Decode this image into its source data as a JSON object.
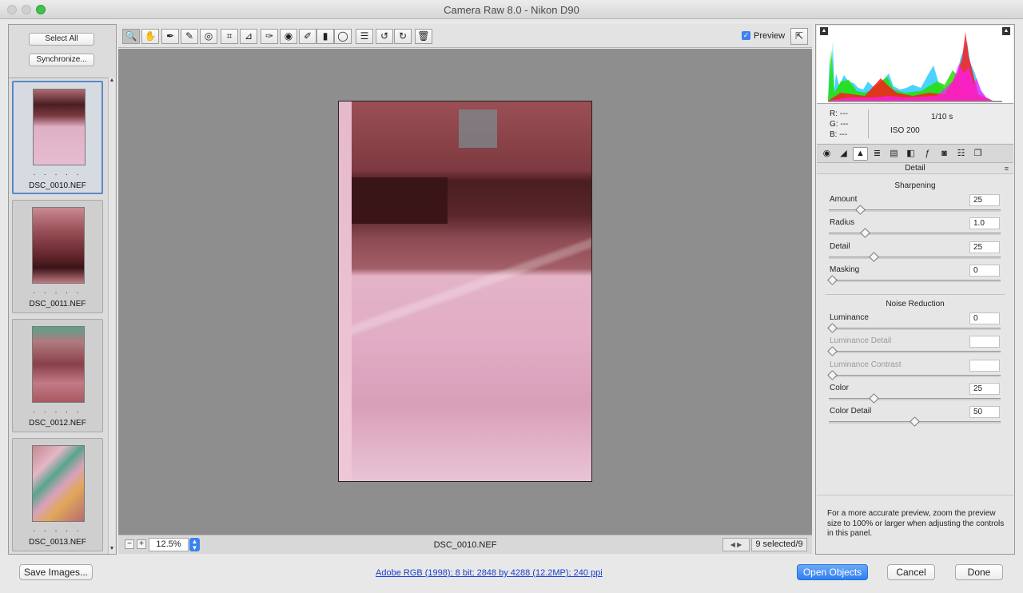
{
  "window": {
    "title": "Camera Raw 8.0  -  Nikon D90"
  },
  "filmstrip": {
    "select_all": "Select All",
    "synchronize": "Synchronize...",
    "items": [
      {
        "name": "DSC_0010.NEF",
        "rating": ". . . . .",
        "selected": true
      },
      {
        "name": "DSC_0011.NEF",
        "rating": ". . . . ."
      },
      {
        "name": "DSC_0012.NEF",
        "rating": ". . . . ."
      },
      {
        "name": "DSC_0013.NEF",
        "rating": ". . . . ."
      }
    ]
  },
  "toolbar": {
    "tools": [
      {
        "name": "zoom-tool",
        "icon": "🔍",
        "active": true
      },
      {
        "name": "hand-tool",
        "icon": "✋"
      },
      {
        "name": "white-balance-tool",
        "icon": "✒"
      },
      {
        "name": "color-sampler-tool",
        "icon": "✎"
      },
      {
        "name": "targeted-adjustment-tool",
        "icon": "◎"
      },
      {
        "name": "crop-tool",
        "icon": "⌗"
      },
      {
        "name": "straighten-tool",
        "icon": "⊿"
      },
      {
        "name": "spot-removal-tool",
        "icon": "✑"
      },
      {
        "name": "red-eye-tool",
        "icon": "◉"
      },
      {
        "name": "adjustment-brush-tool",
        "icon": "✐"
      },
      {
        "name": "graduated-filter-tool",
        "icon": "▮"
      },
      {
        "name": "radial-filter-tool",
        "icon": "◯"
      },
      {
        "name": "preferences-tool",
        "icon": "☰"
      },
      {
        "name": "rotate-left-tool",
        "icon": "↺"
      },
      {
        "name": "rotate-right-tool",
        "icon": "↻"
      },
      {
        "name": "trash-tool",
        "icon": "🗑"
      }
    ],
    "preview_label": "Preview",
    "preview_checked": "✓"
  },
  "status": {
    "zoom_out": "−",
    "zoom_in": "+",
    "zoom_value": "12.5%",
    "filename": "DSC_0010.NEF",
    "nav": "◀ ▶",
    "selected_count": "9 selected/9"
  },
  "readout": {
    "r": "R:  ---",
    "g": "G:  ---",
    "b": "B:  ---",
    "shutter": "1/10 s",
    "iso": "ISO 200"
  },
  "panel": {
    "title": "Detail",
    "menu_icon": "≡",
    "sharpening": {
      "title": "Sharpening",
      "sliders": [
        {
          "label": "Amount",
          "value": "25",
          "pos": 0.17
        },
        {
          "label": "Radius",
          "value": "1.0",
          "pos": 0.2
        },
        {
          "label": "Detail",
          "value": "25",
          "pos": 0.25
        },
        {
          "label": "Masking",
          "value": "0",
          "pos": 0
        }
      ]
    },
    "noise": {
      "title": "Noise Reduction",
      "sliders": [
        {
          "label": "Luminance",
          "value": "0",
          "pos": 0,
          "disabled": false
        },
        {
          "label": "Luminance Detail",
          "value": "",
          "pos": 0,
          "disabled": true
        },
        {
          "label": "Luminance Contrast",
          "value": "",
          "pos": 0,
          "disabled": true
        },
        {
          "label": "Color",
          "value": "25",
          "pos": 0.25,
          "disabled": false
        },
        {
          "label": "Color Detail",
          "value": "50",
          "pos": 0.5,
          "disabled": false
        }
      ]
    },
    "note": "For a more accurate preview, zoom the preview size to 100% or larger when adjusting the controls in this panel."
  },
  "bottom": {
    "save": "Save Images...",
    "workflow": "Adobe RGB (1998); 8 bit; 2848 by 4288 (12.2MP); 240 ppi",
    "open": "Open Objects",
    "cancel": "Cancel",
    "done": "Done"
  },
  "colors": {
    "accent": "#2f7ff0",
    "canvas": "#8e8e8e"
  }
}
